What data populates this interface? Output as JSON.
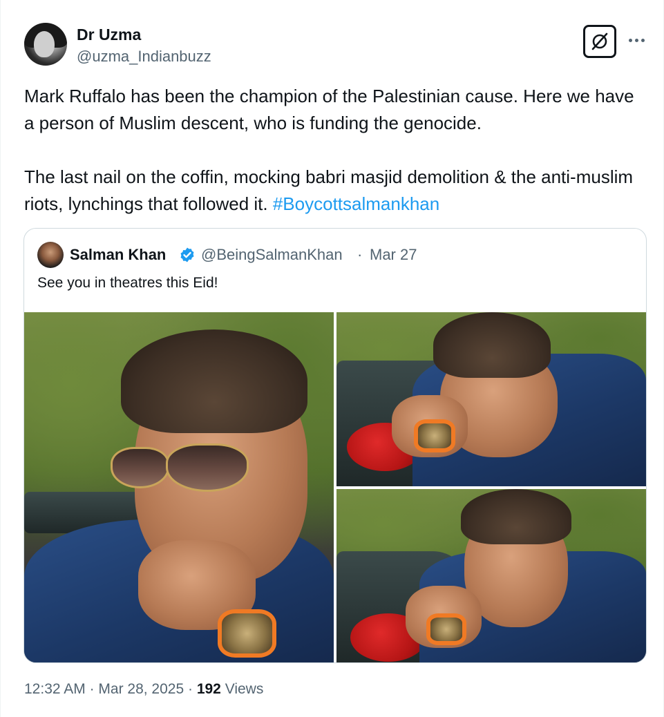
{
  "author": {
    "name": "Dr Uzma",
    "handle": "@uzma_Indianbuzz"
  },
  "actions": {
    "grok_icon": "grok-icon",
    "more_icon": "more-horizontal-icon"
  },
  "tweet": {
    "text_part1": "Mark Ruffalo has been the champion of the Palestinian cause. Here we have a person of Muslim descent, who is funding the genocide.\n\nThe last nail on the coffin, mocking babri masjid demolition & the anti-muslim riots, lynchings that followed it. ",
    "hashtag": "#Boycottsalmankhan"
  },
  "quote": {
    "name": "Salman Khan",
    "verified_icon": "verified-badge-icon",
    "handle": "@BeingSalmanKhan",
    "separator": "·",
    "date": "Mar 27",
    "text": "See you in theatres this Eid!"
  },
  "meta": {
    "time": "12:32 AM",
    "separator": " · ",
    "date": "Mar 28, 2025",
    "separator2": " · ",
    "views_count": "192",
    "views_label": " Views"
  },
  "colors": {
    "text": "#0f1419",
    "secondary": "#536471",
    "link": "#1d9bf0",
    "border": "#cfd9de"
  }
}
